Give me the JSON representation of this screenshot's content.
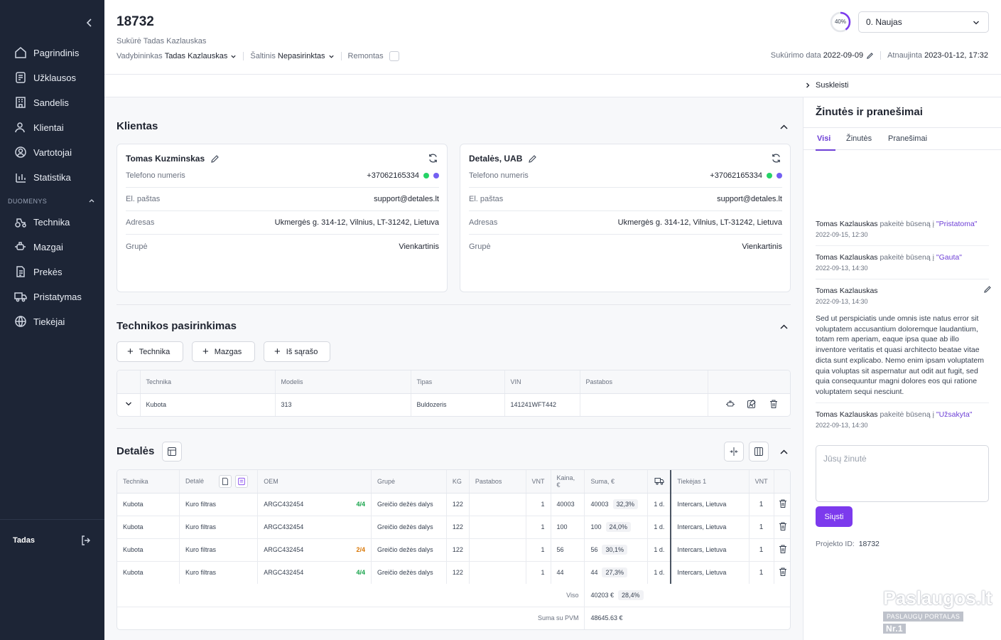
{
  "sidebar": {
    "items": [
      {
        "label": "Pagrindinis",
        "icon": "home-icon"
      },
      {
        "label": "Užklausos",
        "icon": "document-list-icon"
      },
      {
        "label": "Sandelis",
        "icon": "building-icon"
      },
      {
        "label": "Klientai",
        "icon": "users-icon"
      },
      {
        "label": "Vartotojai",
        "icon": "user-circle-icon"
      },
      {
        "label": "Statistika",
        "icon": "chart-icon"
      }
    ],
    "section_label": "DUOMENYS",
    "data_items": [
      {
        "label": "Technika",
        "icon": "tractor-icon"
      },
      {
        "label": "Mazgai",
        "icon": "engine-icon"
      },
      {
        "label": "Prekės",
        "icon": "document-icon"
      },
      {
        "label": "Pristatymas",
        "icon": "truck-icon"
      },
      {
        "label": "Tiekėjai",
        "icon": "globe-icon"
      }
    ],
    "user": "Tadas"
  },
  "header": {
    "title": "18732",
    "created_by": "Sukūrė Tadas Kazlauskas",
    "manager_label": "Vadybininkas",
    "manager_value": "Tadas Kazlauskas",
    "source_label": "Šaltinis",
    "source_value": "Nepasirinktas",
    "repair_label": "Remontas",
    "progress": "40%",
    "progress_fraction": 0.4,
    "status": "0. Naujas",
    "created_date_label": "Sukūrimo data",
    "created_date": "2022-09-09",
    "updated_label": "Atnaujinta",
    "updated": "2023-01-12, 17:32"
  },
  "subbar": {
    "collapse_label": "Suskleisti"
  },
  "clients": {
    "title": "Klientas",
    "cards": [
      {
        "name": "Tomas Kuzminskas",
        "fields": [
          {
            "label": "Telefono numeris",
            "value": "+37062165334"
          },
          {
            "label": "El. paštas",
            "value": "support@detales.lt"
          },
          {
            "label": "Adresas",
            "value": "Ukmergės g. 314-12, Vilnius, LT-31242, Lietuva"
          },
          {
            "label": "Grupė",
            "value": "Vienkartinis"
          }
        ]
      },
      {
        "name": "Detalės, UAB",
        "fields": [
          {
            "label": "Telefono numeris",
            "value": "+37062165334"
          },
          {
            "label": "El. paštas",
            "value": "support@detales.lt"
          },
          {
            "label": "Adresas",
            "value": "Ukmergės g. 314-12, Vilnius, LT-31242, Lietuva"
          },
          {
            "label": "Grupė",
            "value": "Vienkartinis"
          }
        ]
      }
    ]
  },
  "technika": {
    "title": "Technikos pasirinkimas",
    "buttons": [
      "Technika",
      "Mazgas",
      "Iš sąrašo"
    ],
    "columns": [
      "Technika",
      "Modelis",
      "Tipas",
      "VIN",
      "Pastabos"
    ],
    "rows": [
      {
        "technika": "Kubota",
        "modelis": "313",
        "tipas": "Buldozeris",
        "vin": "141241WFT442",
        "pastabos": ""
      }
    ]
  },
  "details": {
    "title": "Detalės",
    "columns": [
      "Technika",
      "Detalė",
      "OEM",
      "Grupė",
      "KG",
      "Pastabos",
      "VNT",
      "Kaina, €",
      "Suma, €",
      "",
      "Tiekėjas 1",
      "VNT"
    ],
    "rows": [
      {
        "technika": "Kubota",
        "detale": "Kuro filtras",
        "oem": "ARGC432454",
        "qty_badge": "4/4",
        "grupe": "Greičio dežės dalys",
        "kg": "122",
        "pastabos": "",
        "vnt": "1",
        "kaina": "40003",
        "suma": "40003",
        "pct": "32,3%",
        "delivery": "1 d.",
        "tiekejas": "Intercars, Lietuva",
        "vnt2": "1"
      },
      {
        "technika": "Kubota",
        "detale": "Kuro filtras",
        "oem": "ARGC432454",
        "qty_badge": "",
        "grupe": "Greičio dežės dalys",
        "kg": "122",
        "pastabos": "",
        "vnt": "1",
        "kaina": "100",
        "suma": "100",
        "pct": "24,0%",
        "delivery": "1 d.",
        "tiekejas": "Intercars, Lietuva",
        "vnt2": "1"
      },
      {
        "technika": "Kubota",
        "detale": "Kuro filtras",
        "oem": "ARGC432454",
        "qty_badge": "2/4",
        "grupe": "Greičio dežės dalys",
        "kg": "122",
        "pastabos": "",
        "vnt": "1",
        "kaina": "56",
        "suma": "56",
        "pct": "30,1%",
        "delivery": "1 d.",
        "tiekejas": "Intercars, Lietuva",
        "vnt2": "1"
      },
      {
        "technika": "Kubota",
        "detale": "Kuro filtras",
        "oem": "ARGC432454",
        "qty_badge": "4/4",
        "grupe": "Greičio dežės dalys",
        "kg": "122",
        "pastabos": "",
        "vnt": "1",
        "kaina": "44",
        "suma": "44",
        "pct": "27,3%",
        "delivery": "1 d.",
        "tiekejas": "Intercars, Lietuva",
        "vnt2": "1"
      }
    ],
    "total_label": "Viso",
    "total_value": "40203 €",
    "total_pct": "28,4%",
    "vat_label": "Suma su PVM",
    "vat_value": "48645.63 €"
  },
  "messages": {
    "title": "Žinutės ir pranešimai",
    "tabs": [
      "Visi",
      "Žinutės",
      "Pranešimai"
    ],
    "items": [
      {
        "author": "Tomas Kazlauskas",
        "action": "pakeitė būseną į",
        "status": "\"Pristatoma\"",
        "time": "2022-09-15, 12:30"
      },
      {
        "author": "Tomas Kazlauskas",
        "action": "pakeitė būseną į",
        "status": "\"Gauta\"",
        "time": "2022-09-13, 14:30"
      },
      {
        "author": "Tomas Kazlauskas",
        "action": "",
        "status": "",
        "time": "2022-09-13, 14:30"
      },
      {
        "author": "Tomas Kazlauskas",
        "action": "pakeitė būseną į",
        "status": "\"Užsakyta\"",
        "time": "2022-09-13, 14:30"
      }
    ],
    "body": "Sed ut perspiciatis unde omnis iste natus error sit voluptatem accusantium doloremque laudantium, totam rem aperiam, eaque ipsa quae ab illo inventore veritatis et quasi architecto beatae vitae dicta sunt explicabo. Nemo enim ipsam voluptatem quia voluptas sit aspernatur aut odit aut fugit, sed quia consequuntur magni dolores eos qui ratione voluptatem sequi nesciunt.",
    "placeholder": "Jūsų žinutė",
    "send_label": "Siųsti",
    "project_id_label": "Projekto ID:",
    "project_id": "18732"
  },
  "watermark": {
    "title": "Paslaugos.lt",
    "subtitle": "PASLAUGŲ PORTALAS",
    "badge": "Nr.1"
  },
  "colors": {
    "sidebar": "#1d2536",
    "accent": "#7c3aed",
    "green": "#16a34a",
    "orange": "#d97706"
  }
}
